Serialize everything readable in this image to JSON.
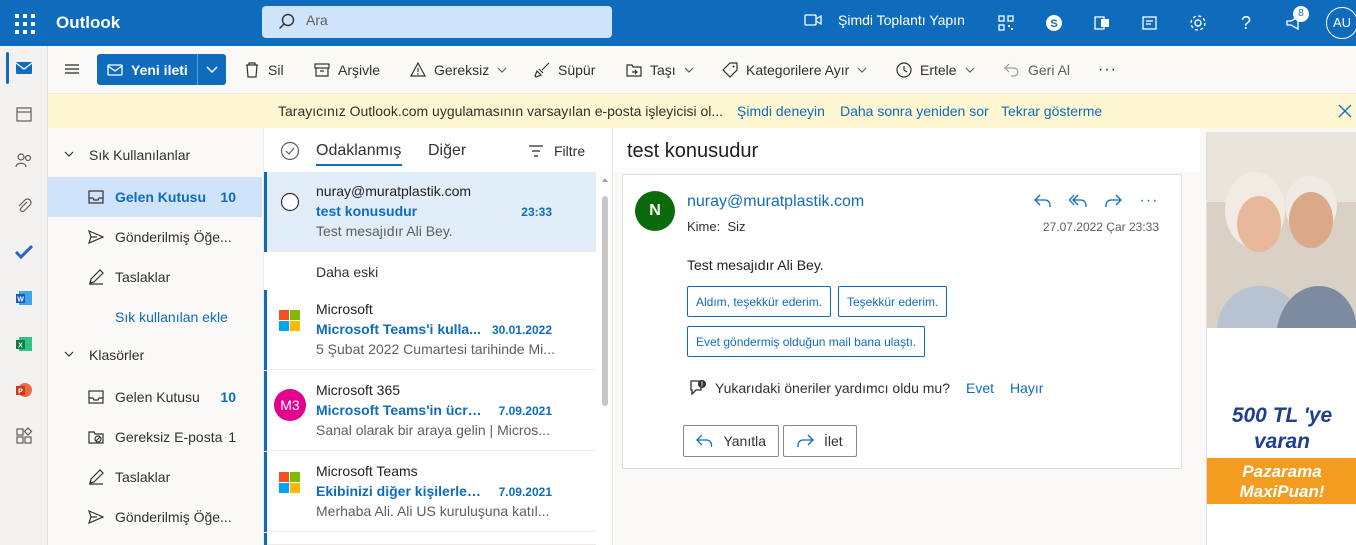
{
  "topbar": {
    "app_name": "Outlook",
    "search_placeholder": "Ara",
    "meet_now_label": "Şimdi Toplantı Yapın",
    "notification_count": "8",
    "user_initials": "AU"
  },
  "commands": {
    "new_message": "Yeni ileti",
    "delete": "Sil",
    "archive": "Arşivle",
    "junk": "Gereksiz",
    "sweep": "Süpür",
    "move": "Taşı",
    "categorize": "Kategorilere Ayır",
    "snooze": "Ertele",
    "undo": "Geri Al",
    "more": "···"
  },
  "infobar": {
    "message": "Tarayıcınız Outlook.com uygulamasının varsayılan e-posta işleyicisi ol...",
    "try_now": "Şimdi deneyin",
    "ask_later": "Daha sonra yeniden sor",
    "dont_show": "Tekrar gösterme"
  },
  "folders": {
    "favorites_header": "Sık Kullanılanlar",
    "fav_inbox": "Gelen Kutusu",
    "fav_inbox_count": "10",
    "fav_sent": "Gönderilmiş Öğe...",
    "fav_drafts": "Taslaklar",
    "add_favorite": "Sık kullanılan ekle",
    "folders_header": "Klasörler",
    "inbox": "Gelen Kutusu",
    "inbox_count": "10",
    "junk": "Gereksiz E-posta",
    "junk_count": "1",
    "drafts": "Taslaklar",
    "sent": "Gönderilmiş Öğe..."
  },
  "list": {
    "tab_focused": "Odaklanmış",
    "tab_other": "Diğer",
    "filter": "Filtre",
    "older_header": "Daha eski",
    "messages": [
      {
        "sender": "nuray@muratplastik.com",
        "subject": "test konusudur",
        "date": "23:33",
        "preview": "Test mesajıdır Ali Bey."
      },
      {
        "sender": "Microsoft",
        "subject": "Microsoft Teams'i kulla...",
        "date": "30.01.2022",
        "preview": "5 Şubat 2022 Cumartesi tarihinde Mi..."
      },
      {
        "sender": "Microsoft 365",
        "subject": "Microsoft Teams'in ücret...",
        "date": "7.09.2021",
        "preview": "Sanal olarak bir araya gelin | Micros...",
        "avatar": "M3"
      },
      {
        "sender": "Microsoft Teams",
        "subject": "Ekibinizi diğer kişilerle p...",
        "date": "7.09.2021",
        "preview": "Merhaba Ali. Ali US kuruluşuna katıl..."
      }
    ]
  },
  "reading": {
    "subject": "test konusudur",
    "from": "nuray@muratplastik.com",
    "avatar_initial": "N",
    "to_label": "Kime:",
    "to_value": "Siz",
    "date": "27.07.2022 Çar 23:33",
    "body": "Test mesajıdır Ali Bey.",
    "suggestions": [
      "Aldım, teşekkür ederim.",
      "Teşekkür ederim.",
      "Evet göndermiş olduğun mail bana ulaştı."
    ],
    "helpful_question": "Yukarıdaki öneriler yardımcı oldu mu?",
    "helpful_yes": "Evet",
    "helpful_no": "Hayır",
    "reply": "Yanıtla",
    "forward": "İlet"
  },
  "ad": {
    "line1": "500 TL 'ye",
    "line2": "varan",
    "orange1": "Pazarama",
    "orange2": "MaxiPuan!"
  },
  "colors": {
    "brand": "#0f6cbd",
    "selection": "#cfe4fa",
    "infobar": "#fff7d1",
    "avatar_n": "#0b6a0b",
    "avatar_m3": "#e3008c"
  }
}
